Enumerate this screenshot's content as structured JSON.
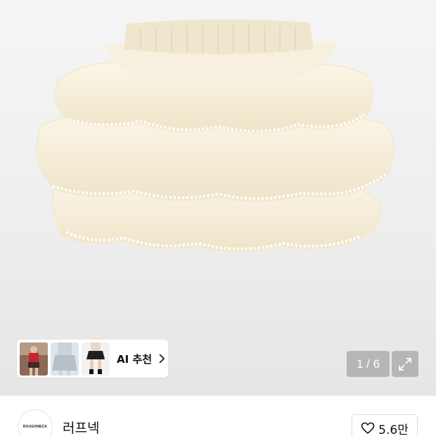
{
  "product": {
    "image_alt": "Cream tiered ruffle tutu skirt",
    "image_index": "1 / 6"
  },
  "ai_recommend": {
    "label": "AI 추천",
    "thumbnails": [
      "red-top-model",
      "light-skirt-model",
      "black-shorts-model"
    ]
  },
  "brand": {
    "logo_text": "ROUGHNECK",
    "name": "러프넥",
    "likes": "5.6만"
  },
  "icons": {
    "expand": "expand-icon",
    "chevron": "chevron-right-icon",
    "heart": "heart-icon"
  },
  "colors": {
    "skirt": "#f6efdc",
    "background": "#eeeeee",
    "overlay": "#8c8c8c"
  }
}
